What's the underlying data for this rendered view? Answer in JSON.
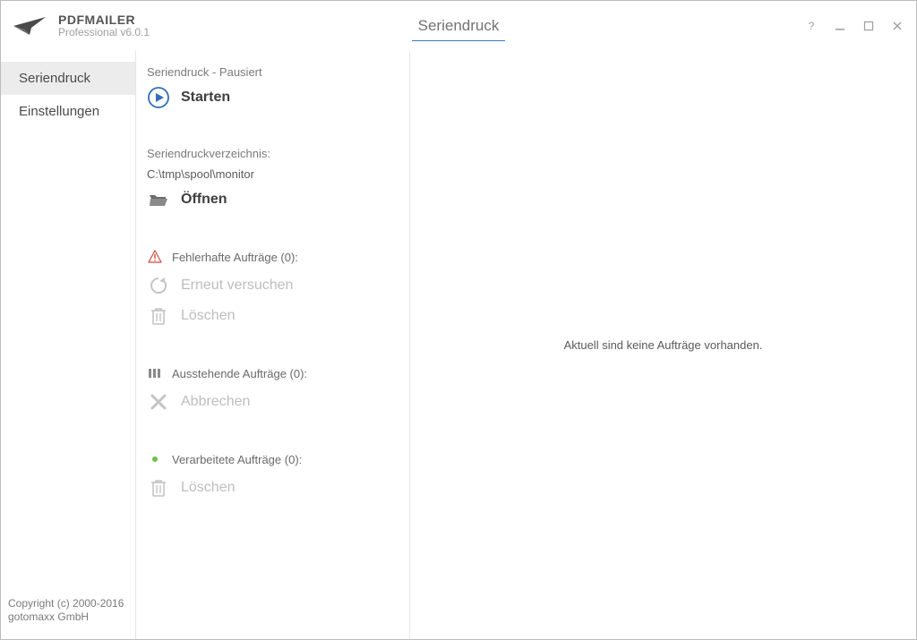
{
  "app": {
    "title": "PDFMAILER",
    "subtitle": "Professional v6.0.1"
  },
  "page": {
    "title": "Seriendruck"
  },
  "nav": {
    "seriendruck": "Seriendruck",
    "einstellungen": "Einstellungen"
  },
  "panel": {
    "status_label": "Seriendruck - Pausiert",
    "start_label": "Starten",
    "dir_label": "Seriendruckverzeichnis:",
    "dir_path": "C:\\tmp\\spool\\monitor",
    "open_label": "Öffnen",
    "failed_label": "Fehlerhafte Aufträge (0):",
    "retry_label": "Erneut versuchen",
    "delete_label": "Löschen",
    "pending_label": "Ausstehende Aufträge (0):",
    "cancel_label": "Abbrechen",
    "processed_label": "Verarbeitete Aufträge (0):",
    "delete2_label": "Löschen"
  },
  "main": {
    "empty": "Aktuell sind keine Aufträge vorhanden."
  },
  "footer": {
    "copyright1": "Copyright (c) 2000-2016",
    "copyright2": "gotomaxx GmbH"
  }
}
